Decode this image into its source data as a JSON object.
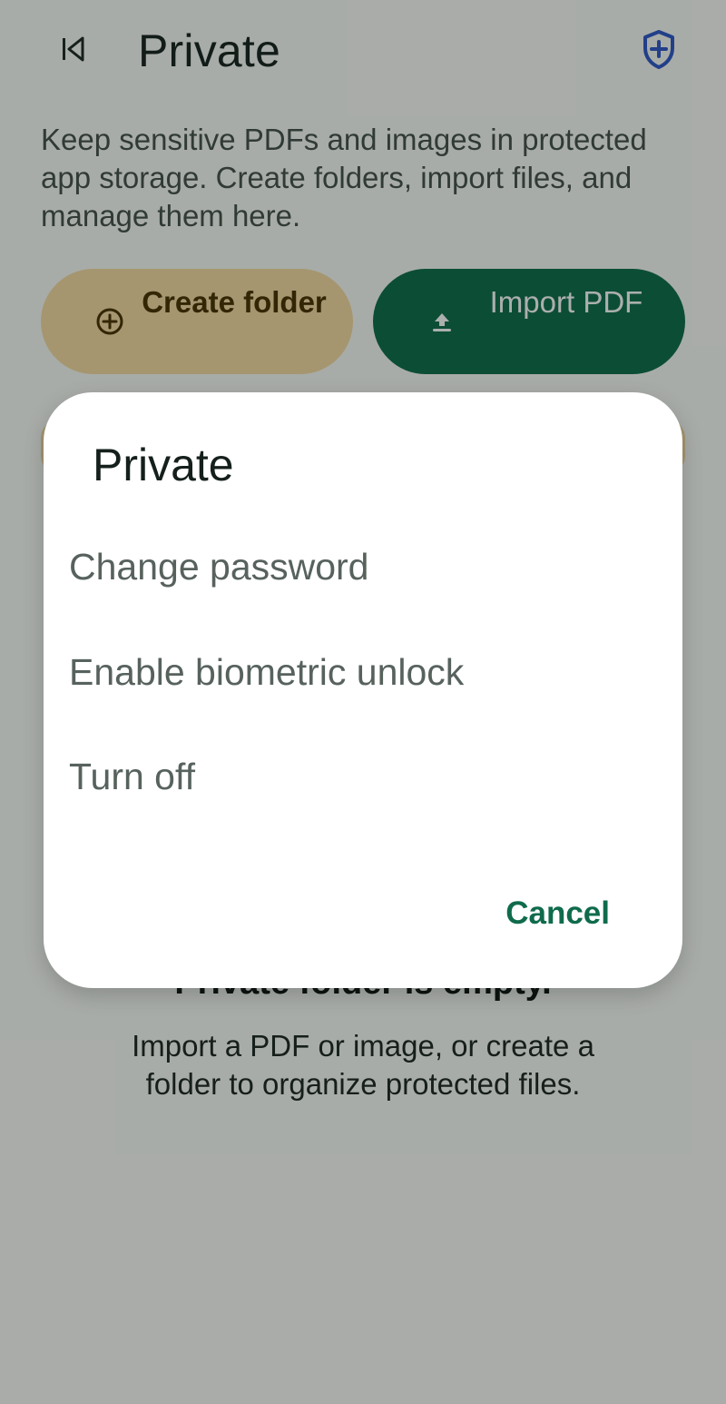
{
  "header": {
    "title": "Private",
    "back_icon": "skip-back-icon",
    "shield_icon": "shield-plus-icon"
  },
  "intro": {
    "text": "Keep sensitive PDFs and images in protected app storage. Create folders, import files, and manage them here."
  },
  "actions": {
    "create_folder": {
      "label": "Create folder",
      "icon": "plus-circle-icon"
    },
    "import_pdf": {
      "label": "Import PDF",
      "icon": "upload-icon"
    }
  },
  "empty_state": {
    "title": "Private folder is empty.",
    "subtitle": "Import a PDF or image, or create a folder to organize protected files."
  },
  "dialog": {
    "title": "Private",
    "items": [
      {
        "label": "Change password"
      },
      {
        "label": "Enable biometric unlock"
      },
      {
        "label": "Turn off"
      }
    ],
    "cancel_label": "Cancel"
  },
  "colors": {
    "accent_green": "#0f6b4b",
    "tonal_yellow": "#f6d9a3",
    "shield_blue": "#2f56c8",
    "scrim": "rgba(10,20,16,0.34)"
  }
}
